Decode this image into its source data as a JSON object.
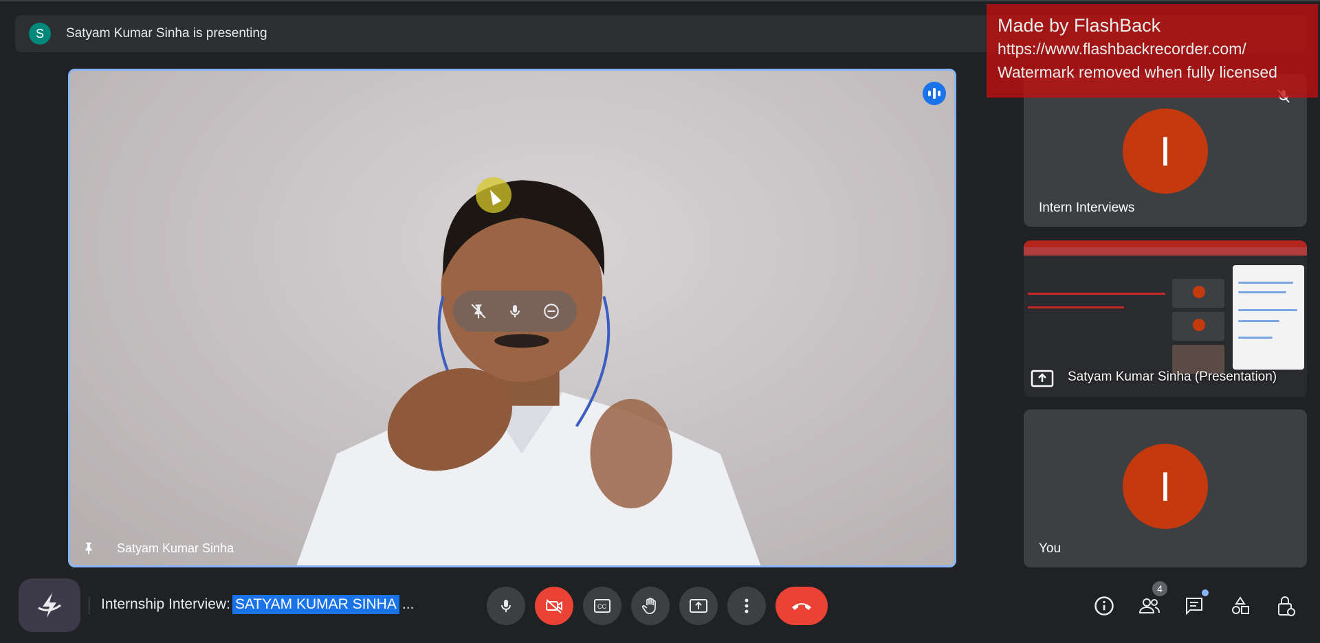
{
  "presenting_bar": {
    "avatar_letter": "S",
    "text": "Satyam Kumar Sinha is presenting"
  },
  "main_video": {
    "participant_name": "Satyam Kumar Sinha"
  },
  "watermark": {
    "line1": "Made by FlashBack",
    "line2": "https://www.flashbackrecorder.com/",
    "line3": "Watermark removed when fully licensed"
  },
  "tiles": [
    {
      "name": "Intern Interviews",
      "avatar_letter": "I"
    },
    {
      "name": "Satyam Kumar Sinha (Presentation)"
    },
    {
      "name": "You",
      "avatar_letter": "I"
    }
  ],
  "meeting": {
    "title_prefix": "Internship Interview: ",
    "title_selected": "SATYAM KUMAR SINHA ",
    "title_ellipsis": "..."
  },
  "people_count": "4",
  "colors": {
    "accent": "#8ab4f8",
    "danger": "#ea4335",
    "avatar": "#c5390f",
    "watermark": "#c41010"
  },
  "icons": {
    "controls": [
      "microphone-icon",
      "camera-off-icon",
      "captions-icon",
      "raise-hand-icon",
      "present-screen-icon",
      "more-options-icon",
      "end-call-icon"
    ],
    "right": [
      "meeting-details-icon",
      "people-icon",
      "chat-icon",
      "activities-icon",
      "host-controls-icon"
    ]
  }
}
